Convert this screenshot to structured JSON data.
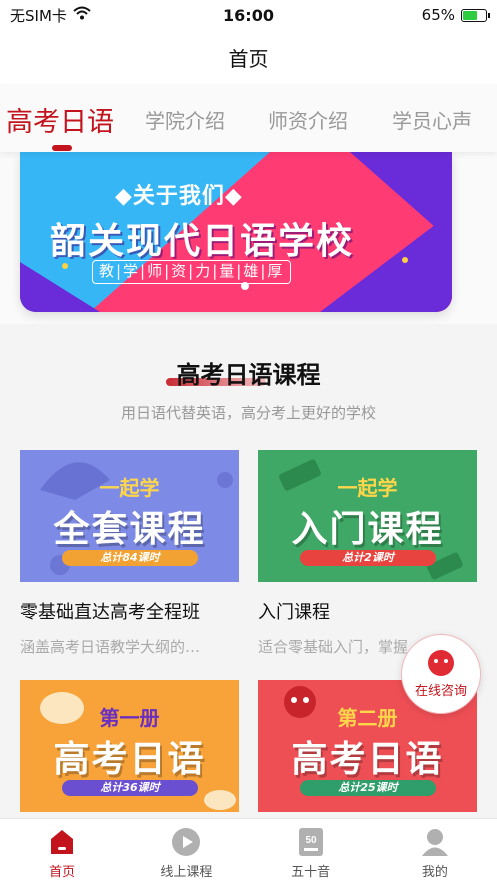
{
  "status_bar": {
    "carrier": "无SIM卡",
    "time": "16:00",
    "battery": "65%",
    "battery_level": 0.65
  },
  "nav": {
    "title": "首页"
  },
  "tabs": [
    {
      "label": "高考日语",
      "active": true
    },
    {
      "label": "学院介绍",
      "active": false
    },
    {
      "label": "师资介绍",
      "active": false
    },
    {
      "label": "学员心声",
      "active": false
    }
  ],
  "banner": {
    "subtitle": "◆关于我们◆",
    "title": "韶关现代日语学校",
    "tag": "教|学|师|资|力|量|雄|厚"
  },
  "section": {
    "title": "高考日语课程",
    "subtitle": "用日语代替英语，高分考上更好的学校"
  },
  "courses": [
    {
      "image_overline": "一起学",
      "image_title": "全套课程",
      "image_pill": "总计84课时",
      "name": "零基础直达高考全程班",
      "desc": "涵盖高考日语教学大纲的…",
      "color": "#7d8be6"
    },
    {
      "image_overline": "一起学",
      "image_title": "入门课程",
      "image_pill": "总计2课时",
      "name": "入门课程",
      "desc": "适合零基础入门，掌握",
      "color": "#3fa866"
    },
    {
      "image_overline": "第一册",
      "image_title": "高考日语",
      "image_pill": "总计36课时",
      "name": "",
      "desc": "",
      "color": "#f7a33a"
    },
    {
      "image_overline": "第二册",
      "image_title": "高考日语",
      "image_pill": "总计25课时",
      "name": "",
      "desc": "",
      "color": "#ee4f55"
    }
  ],
  "float_button": {
    "label": "在线咨询"
  },
  "tabbar": [
    {
      "label": "首页",
      "icon": "home-icon",
      "active": true
    },
    {
      "label": "线上课程",
      "icon": "play-icon",
      "active": false
    },
    {
      "label": "五十音",
      "icon": "fifty-sounds-icon",
      "active": false
    },
    {
      "label": "我的",
      "icon": "user-icon",
      "active": false
    }
  ],
  "colors": {
    "accent": "#c3141e",
    "banner_pink": "#ff3b74",
    "banner_blue": "#37b6f6",
    "banner_purple": "#6a2bd9"
  }
}
